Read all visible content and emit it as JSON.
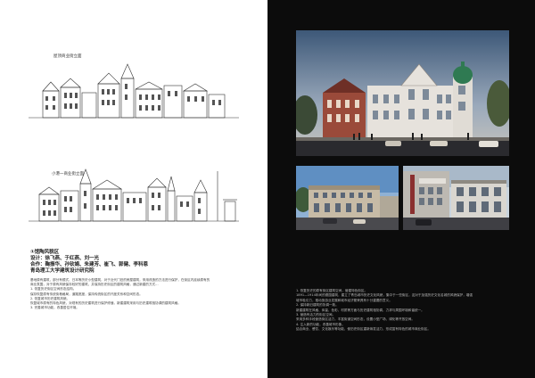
{
  "sketch_top": {
    "label": "屋顶商业街立面"
  },
  "sketch_bottom": {
    "label": "小港一商业街立面"
  },
  "caption": {
    "line1": "①馆陶风貌区",
    "line2": "设计：徐飞燕、于红燕、刘一光",
    "line3": "合作：鞠振华、孙钦娟、朱建芳、崔飞、郭健、李科恩",
    "line4": "青岛理工大学建筑设计研究院"
  },
  "left_text": [
    "基地原有建筑，部分有德式、日本等历史小型建筑，对于近代门旧的房屋建筑，采用改造的方法进行保护，在街区内延续原有的",
    "商业氛围，对于原有风貌保存较好的建筑，并保持历史街区的建筑风格，通过新建的方式...",
    "1. 恢复历史街区空间形态结构。",
    "保存恢复原有传统街巷格局，道路宽度，保持传统街区的尺度关系和空间形态。",
    "2. 恢复城市历史建筑风貌。",
    "恢复城市原有的特色风貌，对现有的历史建筑进行保护修缮，新建建筑采用与历史建筑相协调的建筑风格。",
    "3. 完善城市功能，改善居住环境。"
  ],
  "right_text": [
    "1. 恢复历史的原有街区建筑空间，营建特色街区。",
    "1891—1914年间的德国建筑，建立了青岛城市历史文化风貌，集中于一些街区，这对于加强历史文化名城的风貌保护，增强",
    "城市吸引力，推动旅游业发展和城市经济繁荣具有十分重要的意义。",
    "2. 保持新旧建筑的协调一致。",
    "新建建筑在风格、体量、色彩、材质等方面与历史建筑相协调，力求与周围环境和谐统一。",
    "3. 营造有活力的街区空间。",
    "采用多种手段营造街区活力，丰富街道空间形态，设置小型广场、绿化等开放空间。",
    "4. 注入新的功能，改善城市形象。",
    "结合商业、餐饮、文化娱乐等功能，使历史街区重新焕发活力，形成富有特色的城市商业街区。"
  ]
}
